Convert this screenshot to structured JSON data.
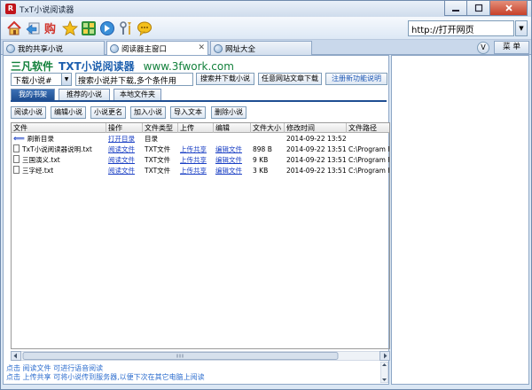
{
  "window": {
    "title": "TxT小说阅读器",
    "app_icon": "R",
    "colors": {
      "brand_green": "#12803b",
      "brand_blue": "#1d5fae",
      "link_blue": "#1a3fc4",
      "active_tab": "#1e4e92",
      "close_red": "#c7402a"
    }
  },
  "toolbar": {
    "icons": [
      "home-icon",
      "back-icon",
      "shop-icon",
      "star-icon",
      "app-grid-icon",
      "forward-icon",
      "tools-icon",
      "chat-icon"
    ],
    "address": "http://打开网页"
  },
  "tabs": [
    {
      "label": "我的共享小说"
    },
    {
      "label": "阅读器主窗口",
      "active": true
    },
    {
      "label": "网址大全"
    }
  ],
  "tabstrip": {
    "v_label": "V",
    "menu_label": "菜 单"
  },
  "brand": {
    "name": "三凡软件",
    "product": "TXT小说阅读器",
    "site": "www.3fwork.com"
  },
  "search": {
    "select_value": "下载小说#",
    "input_value": "搜索小说并下载,多个条件用",
    "buttons": [
      "搜索并下载小说",
      "任意网站文章下载",
      "注册新功能说明"
    ]
  },
  "subtabs": [
    "我的书架",
    "推荐的小说",
    "本地文件夹"
  ],
  "actions": [
    "阅读小说",
    "编辑小说",
    "小说更名",
    "加入小说",
    "导入文本",
    "删除小说"
  ],
  "table": {
    "headers": [
      "文件",
      "操作",
      "文件类型",
      "上传",
      "编辑",
      "文件大小",
      "修改时间",
      "文件路径"
    ],
    "rows": [
      {
        "name": "刷新目录",
        "op": "打开目录",
        "type": "目录",
        "upload": "",
        "edit": "",
        "size": "",
        "time": "2014-09-22 13:52",
        "path": ""
      },
      {
        "name": "TxT小说阅读器说明.txt",
        "op": "阅读文件",
        "type": "TXT文件",
        "upload": "上传共享",
        "edit": "编辑文件",
        "size": "898 B",
        "time": "2014-09-22 13:51",
        "path": "C:\\Program F"
      },
      {
        "name": "三国演义.txt",
        "op": "阅读文件",
        "type": "TXT文件",
        "upload": "上传共享",
        "edit": "编辑文件",
        "size": "9 KB",
        "time": "2014-09-22 13:51",
        "path": "C:\\Program F"
      },
      {
        "name": "三字经.txt",
        "op": "阅读文件",
        "type": "TXT文件",
        "upload": "上传共享",
        "edit": "编辑文件",
        "size": "3 KB",
        "time": "2014-09-22 13:51",
        "path": "C:\\Program F"
      }
    ]
  },
  "status": [
    "点击 阅读文件 可进行语音阅读",
    "点击 上传共享 可将小说传到服务器,以便下次在其它电脑上阅读"
  ]
}
